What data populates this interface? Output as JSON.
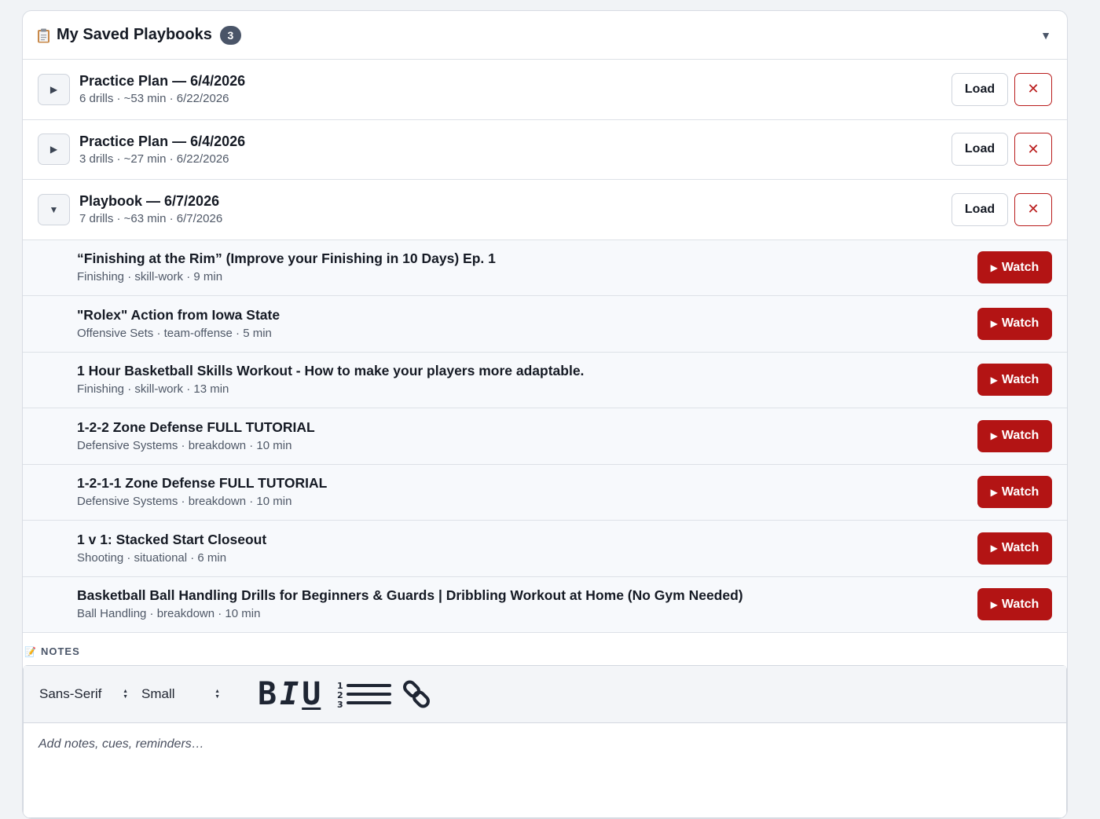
{
  "header": {
    "title": "My Saved Playbooks",
    "count": "3",
    "collapse_icon": "chevron-down-icon"
  },
  "playbooks": [
    {
      "title": "Practice Plan — 6/4/2026",
      "meta": "6 drills · ~53 min · 6/22/2026",
      "expanded": false,
      "load_label": "Load",
      "delete_icon": "close-icon"
    },
    {
      "title": "Practice Plan — 6/4/2026",
      "meta": "3 drills · ~27 min · 6/22/2026",
      "expanded": false,
      "load_label": "Load",
      "delete_icon": "close-icon"
    },
    {
      "title": "Playbook — 6/7/2026",
      "meta": "7 drills · ~63 min · 6/7/2026",
      "expanded": true,
      "load_label": "Load",
      "delete_icon": "close-icon"
    }
  ],
  "drills": [
    {
      "title": "“Finishing at the Rim” (Improve your Finishing in 10 Days) Ep. 1",
      "meta": "Finishing · skill-work · 9 min",
      "watch_label": "Watch"
    },
    {
      "title": "\"Rolex\" Action from Iowa State",
      "meta": "Offensive Sets · team-offense · 5 min",
      "watch_label": "Watch"
    },
    {
      "title": "1 Hour Basketball Skills Workout - How to make your players more adaptable.",
      "meta": "Finishing · skill-work · 13 min",
      "watch_label": "Watch"
    },
    {
      "title": "1-2-2 Zone Defense FULL TUTORIAL",
      "meta": "Defensive Systems · breakdown · 10 min",
      "watch_label": "Watch"
    },
    {
      "title": "1-2-1-1 Zone Defense FULL TUTORIAL",
      "meta": "Defensive Systems · breakdown · 10 min",
      "watch_label": "Watch"
    },
    {
      "title": "1 v 1: Stacked Start Closeout",
      "meta": "Shooting · situational · 6 min",
      "watch_label": "Watch"
    },
    {
      "title": "Basketball Ball Handling Drills for Beginners & Guards | Dribbling Workout at Home (No Gym Needed)",
      "meta": "Ball Handling · breakdown · 10 min",
      "watch_label": "Watch"
    }
  ],
  "notes": {
    "label": "NOTES",
    "font_select": "Sans-Serif",
    "size_select": "Small",
    "bold_label": "B",
    "italic_label": "I",
    "underline_label": "U",
    "placeholder": "Add notes, cues, reminders…"
  },
  "colors": {
    "accent_red": "#b31414",
    "badge": "#4a5568"
  }
}
